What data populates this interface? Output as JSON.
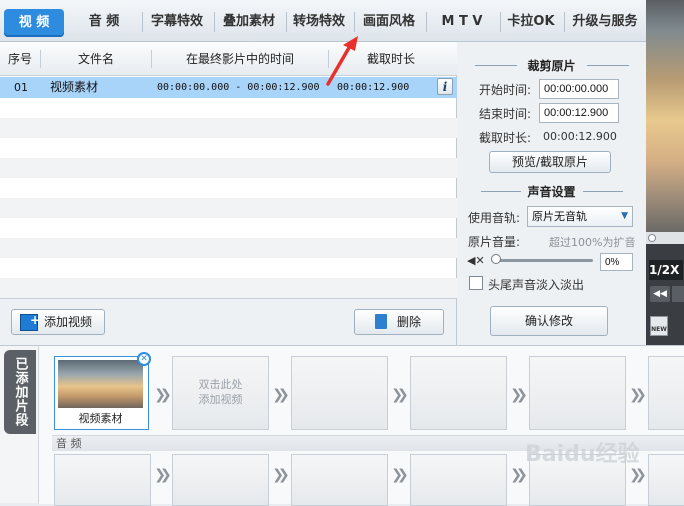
{
  "tabs": {
    "video": "视 频",
    "audio": "音 频",
    "subtitle_effects": "字幕特效",
    "overlay_material": "叠加素材",
    "transition_effects": "转场特效",
    "picture_style": "画面风格",
    "mtv": "M T V",
    "karaoke": "卡拉OK",
    "upgrade_service": "升级与服务"
  },
  "table": {
    "headers": {
      "index": "序号",
      "filename": "文件名",
      "time_in_final": "在最终影片中的时间",
      "clip_duration": "截取时长"
    },
    "rows": [
      {
        "index": "01",
        "filename": "视频素材",
        "time_in_final": "00:00:00.000 - 00:00:12.900",
        "clip_duration": "00:00:12.900"
      }
    ],
    "info_label": "i"
  },
  "table_buttons": {
    "add_video": "添加视频",
    "delete": "删除"
  },
  "crop_panel": {
    "title": "裁剪原片",
    "start_label": "开始时间:",
    "start_value": "00:00:00.000",
    "end_label": "结束时间:",
    "end_value": "00:00:12.900",
    "duration_label": "截取时长:",
    "duration_value": "00:00:12.900",
    "preview_button": "预览/截取原片"
  },
  "sound_panel": {
    "title": "声音设置",
    "track_label": "使用音轨:",
    "track_value": "原片无音轨",
    "volume_label": "原片音量:",
    "volume_hint": "超过100%为扩音",
    "volume_value": "0%",
    "fade_label": "头尾声音淡入淡出",
    "confirm_button": "确认修改"
  },
  "preview": {
    "speed_label": "1/2X",
    "new_badge": "NEW"
  },
  "clips": {
    "tab_label": "已添加片段",
    "clip1_label": "视频素材",
    "placeholder_text": "双击此处\n添加视频",
    "audio_label": "音 频"
  },
  "watermark": "Baidu经验",
  "colors": {
    "accent": "#2d8be0",
    "row_selected": "#a9d4fa",
    "annotation_arrow": "#e8302c"
  }
}
